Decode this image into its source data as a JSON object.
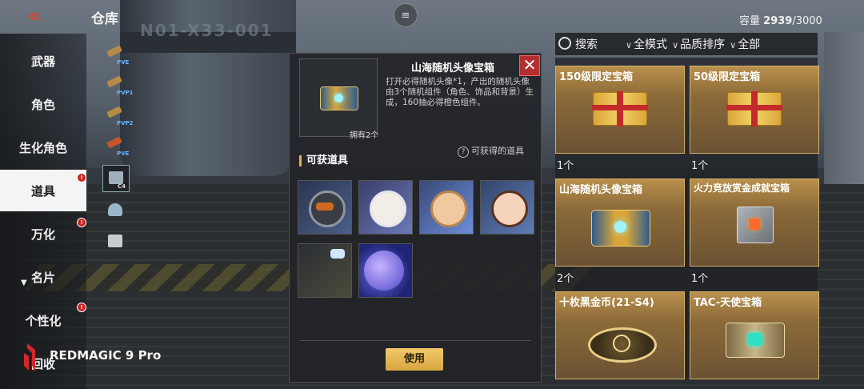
{
  "header": {
    "back_icon": "double-chevron-left-icon",
    "title": "仓库",
    "capacity_label": "容量",
    "capacity_value": "2939",
    "capacity_max": "/3000"
  },
  "background": {
    "hangar_text": "N01-X33-001"
  },
  "sidebar": {
    "items": [
      {
        "label": "武器",
        "badge": false
      },
      {
        "label": "角色",
        "badge": false
      },
      {
        "label": "生化角色",
        "badge": false
      },
      {
        "label": "道具",
        "badge": true,
        "active": true
      },
      {
        "label": "万化",
        "badge": true
      },
      {
        "label": "名片",
        "badge": false
      },
      {
        "label": "个性化",
        "badge": true
      },
      {
        "label": "回收",
        "badge": false
      }
    ]
  },
  "sub_categories": [
    {
      "tag": "PVE",
      "icon": "gun-icon"
    },
    {
      "tag": "PVP1",
      "icon": "gun-icon"
    },
    {
      "tag": "PVP2",
      "icon": "gun-icon"
    },
    {
      "tag": "PVE",
      "icon": "gun-icon"
    },
    {
      "tag": "C4",
      "icon": "c4-box-icon",
      "active": true
    },
    {
      "tag": "",
      "icon": "helmet-icon"
    },
    {
      "tag": "",
      "icon": "gear-box-icon"
    }
  ],
  "dialog": {
    "title": "山海随机头像宝箱",
    "owned": "拥有2个",
    "description": "打开必得随机头像*1，产出的随机头像由3个随机组件（角色、饰品和背景）生成，160抽必得橙色组件。",
    "section_title": "可获道具",
    "help_label": "可获得的道具",
    "use_button": "使用",
    "rewards": [
      {
        "icon": "helmet-avatar-icon"
      },
      {
        "icon": "white-hair-avatar-icon"
      },
      {
        "icon": "blonde-avatar-icon"
      },
      {
        "icon": "brown-hair-avatar-icon"
      },
      {
        "icon": "ornament-icon"
      },
      {
        "icon": "planet-background-icon"
      }
    ]
  },
  "filter_bar": {
    "search_label": "搜索",
    "mode_label": "全模式",
    "sort_label": "品质排序",
    "all_label": "全部"
  },
  "inventory": [
    {
      "name": "150级限定宝箱",
      "qty": "1个",
      "art": "gift-box-icon"
    },
    {
      "name": "50级限定宝箱",
      "qty": "1个",
      "art": "gift-box-icon"
    },
    {
      "name": "山海随机头像宝箱",
      "qty": "2个",
      "art": "treasure-chest-icon"
    },
    {
      "name": "火力竞放赏金成就宝箱",
      "qty": "1个",
      "art": "metal-chest-icon"
    },
    {
      "name": "十枚黑金币(21-S4)",
      "qty": "",
      "art": "coin-icon"
    },
    {
      "name": "TAC-天使宝箱",
      "qty": "",
      "art": "tac-chest-icon"
    }
  ],
  "branding": {
    "text": "REDMAGIC 9 Pro"
  },
  "colors": {
    "accent_gold": "#e8b04a",
    "close_red": "#b32f2f",
    "badge_red": "#c92424",
    "card_gold": "#b9904c"
  }
}
